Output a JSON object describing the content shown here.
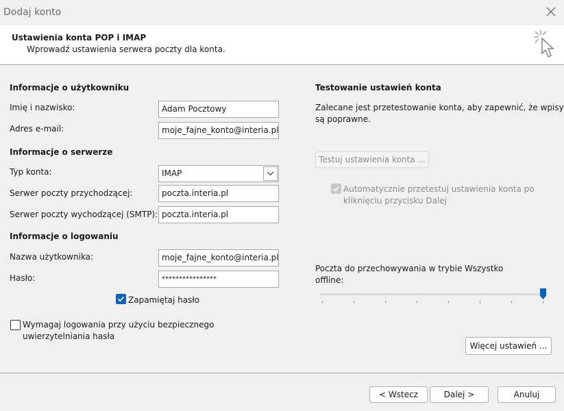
{
  "window": {
    "title": "Dodaj konto"
  },
  "header": {
    "title": "Ustawienia konta POP i IMAP",
    "subtitle": "Wprowadź ustawienia serwera poczty dla konta."
  },
  "user_info": {
    "heading": "Informacje o użytkowniku",
    "name_label": "Imię i nazwisko:",
    "name_value": "Adam Pocztowy",
    "email_label": "Adres e-mail:",
    "email_value": "moje_fajne_konto@interia.pl"
  },
  "server_info": {
    "heading": "Informacje o serwerze",
    "account_type_label": "Typ konta:",
    "account_type_value": "IMAP",
    "incoming_label": "Serwer poczty przychodzącej:",
    "incoming_value": "poczta.interia.pl",
    "outgoing_label": "Serwer poczty wychodzącej (SMTP):",
    "outgoing_value": "poczta.interia.pl"
  },
  "login_info": {
    "heading": "Informacje o logowaniu",
    "username_label": "Nazwa użytkownika:",
    "username_value": "moje_fajne_konto@interia.pl",
    "password_label": "Hasło:",
    "password_value": "****************",
    "remember_label": "Zapamiętaj hasło",
    "remember_checked": true,
    "spa_label_line1": "Wymagaj logowania przy użyciu bezpiecznego",
    "spa_label_line2": "uwierzytelniania hasła",
    "spa_checked": false
  },
  "test_settings": {
    "heading": "Testowanie ustawień konta",
    "desc_line1": "Zalecane jest przetestowanie konta, aby zapewnić, że wpisy",
    "desc_line2": "są poprawne.",
    "test_button": "Testuj ustawienia konta ...",
    "auto_test_line1": "Automatycznie przetestuj ustawienia konta po",
    "auto_test_line2": "kliknięciu przycisku Dalej",
    "auto_test_checked": true
  },
  "offline": {
    "label_line1": "Poczta do przechowywania w trybie",
    "label_line2": "offline:",
    "value": "Wszystko",
    "slider_fraction": 1.0
  },
  "more_settings_button": "Więcej ustawień ...",
  "footer": {
    "back": "< Wstecz",
    "next": "Dalej >",
    "cancel": "Anuluj"
  },
  "colors": {
    "accent": "#0f62b8",
    "header_bg": "#ffffff",
    "dialog_bg": "#f0f0f0"
  },
  "icons": [
    "close-icon",
    "wizard-cursor-icon",
    "chevron-down-icon",
    "checkmark-icon",
    "slider-thumb-icon"
  ]
}
